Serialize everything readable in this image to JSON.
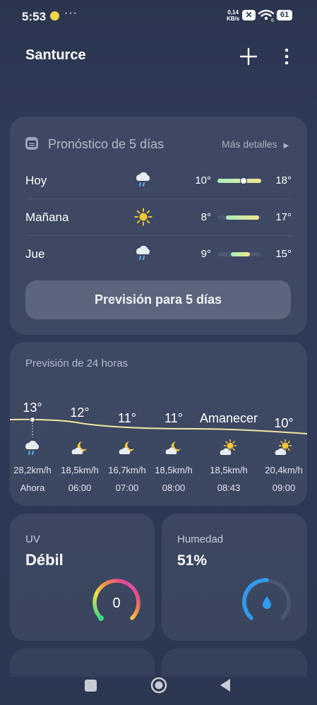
{
  "status_bar": {
    "time": "5:53",
    "dots": "···",
    "speed_value": "0,14",
    "speed_unit": "KB/s",
    "wifi_sub": "6",
    "battery": "61"
  },
  "header": {
    "city": "Santurce"
  },
  "forecast5": {
    "title": "Pronóstico de 5 días",
    "more_link": "Más detalles",
    "days": [
      {
        "name": "Hoy",
        "icon": "rain-cloud-icon",
        "low": "10°",
        "high": "18°",
        "bar_start": 0.0,
        "bar_end": 1.0,
        "current": 0.6
      },
      {
        "name": "Mañana",
        "icon": "sun-icon",
        "low": "8°",
        "high": "17°",
        "bar_start": 0.2,
        "bar_end": 0.95
      },
      {
        "name": "Jue",
        "icon": "rain-cloud-icon",
        "low": "9°",
        "high": "15°",
        "bar_start": 0.3,
        "bar_end": 0.75
      }
    ],
    "button": "Previsión para 5 días"
  },
  "forecast24": {
    "title": "Previsión de 24 horas",
    "hours": [
      {
        "temp": "13°",
        "icon": "rain-cloud-icon",
        "wind": "28,2km/h",
        "time": "Ahora"
      },
      {
        "temp": "12°",
        "icon": "moon-cloud-icon",
        "wind": "18,5km/h",
        "time": "06:00"
      },
      {
        "temp": "11°",
        "icon": "moon-cloud-icon",
        "wind": "16,7km/h",
        "time": "07:00"
      },
      {
        "temp": "11°",
        "icon": "moon-cloud-icon",
        "wind": "18,5km/h",
        "time": "08:00"
      },
      {
        "temp": "Amanecer",
        "icon": "sun-cloud-icon",
        "wind": "18,5km/h",
        "time": "08:43"
      },
      {
        "temp": "10°",
        "icon": "sun-cloud-icon",
        "wind": "20,4km/h",
        "time": "09:00"
      }
    ]
  },
  "uv": {
    "label": "UV",
    "value": "Débil",
    "index": "0"
  },
  "humidity": {
    "label": "Humedad",
    "value": "51%"
  },
  "colors": {
    "accent_bar_from": "#a9f0c0",
    "accent_bar_to": "#f1e58a",
    "humidity_blue": "#2f9cf0"
  }
}
